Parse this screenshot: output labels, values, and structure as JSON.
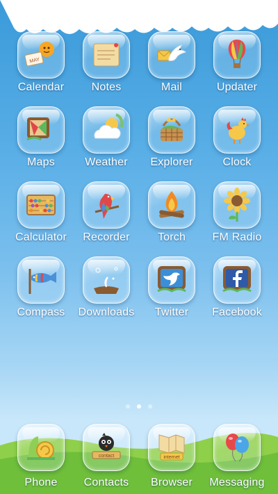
{
  "home": {
    "apps": [
      {
        "name": "Calendar",
        "icon": "calendar-icon"
      },
      {
        "name": "Notes",
        "icon": "notes-icon"
      },
      {
        "name": "Mail",
        "icon": "mail-icon"
      },
      {
        "name": "Updater",
        "icon": "balloon-icon"
      },
      {
        "name": "Maps",
        "icon": "maps-icon"
      },
      {
        "name": "Weather",
        "icon": "weather-icon"
      },
      {
        "name": "Explorer",
        "icon": "basket-icon"
      },
      {
        "name": "Clock",
        "icon": "rooster-icon"
      },
      {
        "name": "Calculator",
        "icon": "abacus-icon"
      },
      {
        "name": "Recorder",
        "icon": "parrot-icon"
      },
      {
        "name": "Torch",
        "icon": "campfire-icon"
      },
      {
        "name": "FM Radio",
        "icon": "sunflower-icon"
      },
      {
        "name": "Compass",
        "icon": "windsock-fish-icon"
      },
      {
        "name": "Downloads",
        "icon": "downloads-bubble-icon"
      },
      {
        "name": "Twitter",
        "icon": "twitter-icon"
      },
      {
        "name": "Facebook",
        "icon": "facebook-icon"
      }
    ],
    "calendar_stamp": "MAY"
  },
  "pager": {
    "count": 3,
    "active": 1
  },
  "dock": {
    "apps": [
      {
        "name": "Phone",
        "icon": "snail-phone-icon"
      },
      {
        "name": "Contacts",
        "icon": "bird-contacts-icon"
      },
      {
        "name": "Browser",
        "icon": "map-sign-browser-icon"
      },
      {
        "name": "Messaging",
        "icon": "balloons-messaging-icon"
      }
    ],
    "contacts_sign": "contact",
    "browser_sign": "internet"
  },
  "colors": {
    "sky_top": "#3a9ad9",
    "sky_bottom": "#c8e7fa",
    "grass": "#6fbf3a",
    "label": "#ffffff"
  }
}
